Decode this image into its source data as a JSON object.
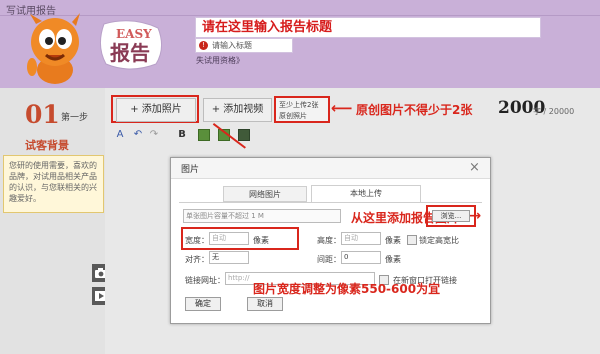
{
  "header": {
    "page_title": "写试用报告",
    "title_callout": "请在这里输入报告标题",
    "title_error": "请输入标题",
    "trial_link": "失试用资格》",
    "logo_small": "EASY",
    "logo_big": "报告",
    "colors": {
      "header_bg": "#c9b0d8",
      "accent_red": "#d9261c"
    }
  },
  "sidebar": {
    "step_number": "01",
    "step_label": "第一步",
    "step_title": "试客背景",
    "tip": "您研的使用需要，喜欢的品牌，对试用品相关产品的认识，与您联相关的兴趣爱好。"
  },
  "editor": {
    "add_photo_label": "+ 添加照片",
    "add_video_label": "+ 添加视频",
    "upload_note_line1": "至少上传2张",
    "upload_note_line2": "原创照片",
    "photo_callout": "原创图片不得少于2张",
    "word_count": "2000",
    "word_count_sub": "字 / 20000",
    "toolbar_icons": [
      "font-icon",
      "undo-icon",
      "redo-icon",
      "bold-icon",
      "image-icon",
      "table-icon",
      "save-icon"
    ],
    "toolbar_bold": "B"
  },
  "dialog": {
    "title": "图片",
    "close": "×",
    "tab_network": "网络图片",
    "tab_local": "本地上传",
    "file_hint": "单张图片容量不超过 1 M",
    "upload_callout": "从这里添加报告图片",
    "browse_label": "浏览...",
    "width_label": "宽度：",
    "width_placeholder": "自动",
    "width_unit": "像素",
    "height_label": "高度：",
    "height_placeholder": "自动",
    "height_unit": "像素",
    "lock_label": "锁定高宽比",
    "align_label": "对齐：",
    "align_value": "无",
    "spacing_label": "间距：",
    "spacing_value": "0",
    "spacing_unit": "像素",
    "link_label": "链接网址：",
    "link_placeholder": "http://",
    "newwin_label": "在新窗口打开链接",
    "width_callout": "图片宽度调整为像素550-600为宜",
    "ok_label": "确定",
    "cancel_label": "取消"
  }
}
